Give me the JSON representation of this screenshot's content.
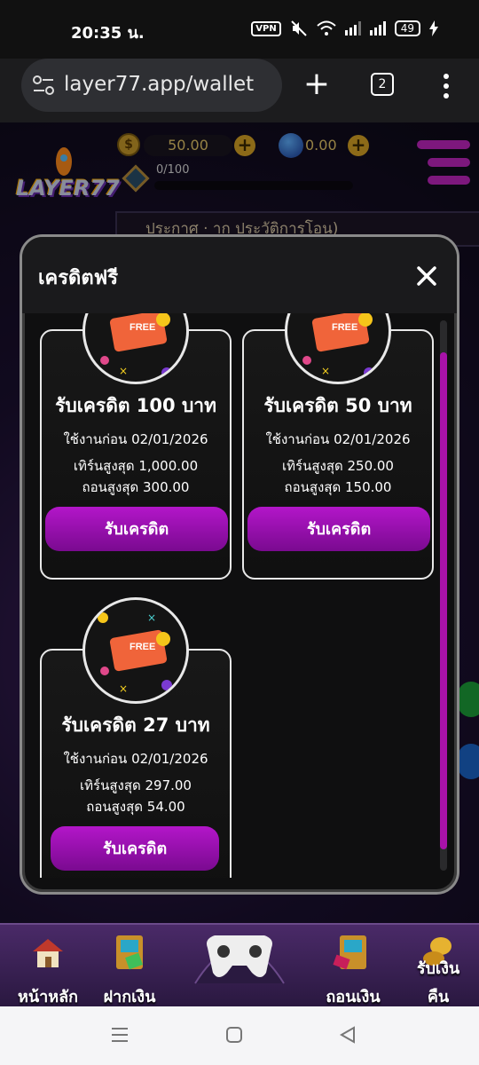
{
  "status_bar": {
    "time": "20:35 น.",
    "vpn": "VPN",
    "battery": "49"
  },
  "browser": {
    "url": "layer77.app/wallet",
    "tab_count": "2"
  },
  "header": {
    "logo_text": "LAYER77",
    "coin_balance": "50.00",
    "coin_symbol": "$",
    "gem_balance": "0.00",
    "xp_label": "0/100",
    "tab_strip_text": "ประกาศ ·  าก ประวัติการโอน)"
  },
  "modal": {
    "title": "เครดิตฟรี",
    "badge_label": "FREE",
    "cards": [
      {
        "title": "รับเครดิต 100 บาท",
        "valid": "ใช้งานก่อน 02/01/2026",
        "max_turnover": "เทิร์นสูงสุด 1,000.00",
        "max_withdraw": "ถอนสูงสุด 300.00",
        "button": "รับเครดิต"
      },
      {
        "title": "รับเครดิต 50 บาท",
        "valid": "ใช้งานก่อน 02/01/2026",
        "max_turnover": "เทิร์นสูงสุด 250.00",
        "max_withdraw": "ถอนสูงสุด 150.00",
        "button": "รับเครดิต"
      },
      {
        "title": "รับเครดิต 27 บาท",
        "valid": "ใช้งานก่อน 02/01/2026",
        "max_turnover": "เทิร์นสูงสุด 297.00",
        "max_withdraw": "ถอนสูงสุด 54.00",
        "button": "รับเครดิต"
      }
    ]
  },
  "bottom_nav": {
    "home": "หน้าหลัก",
    "deposit": "ฝากเงิน",
    "withdraw": "ถอนเงิน",
    "cashback_line1": "รับเงิน",
    "cashback_line2": "คืน"
  },
  "colors": {
    "accent": "#a812a8",
    "gold": "#d7a326"
  },
  "icons": [
    "tune-icon",
    "plus-icon",
    "tabs-icon",
    "more-vert-icon",
    "close-icon",
    "coin-icon",
    "gem-icon",
    "house-icon",
    "atm-icon",
    "gamepad-icon",
    "menu-icon",
    "back-icon",
    "home-icon",
    "recents-icon"
  ]
}
